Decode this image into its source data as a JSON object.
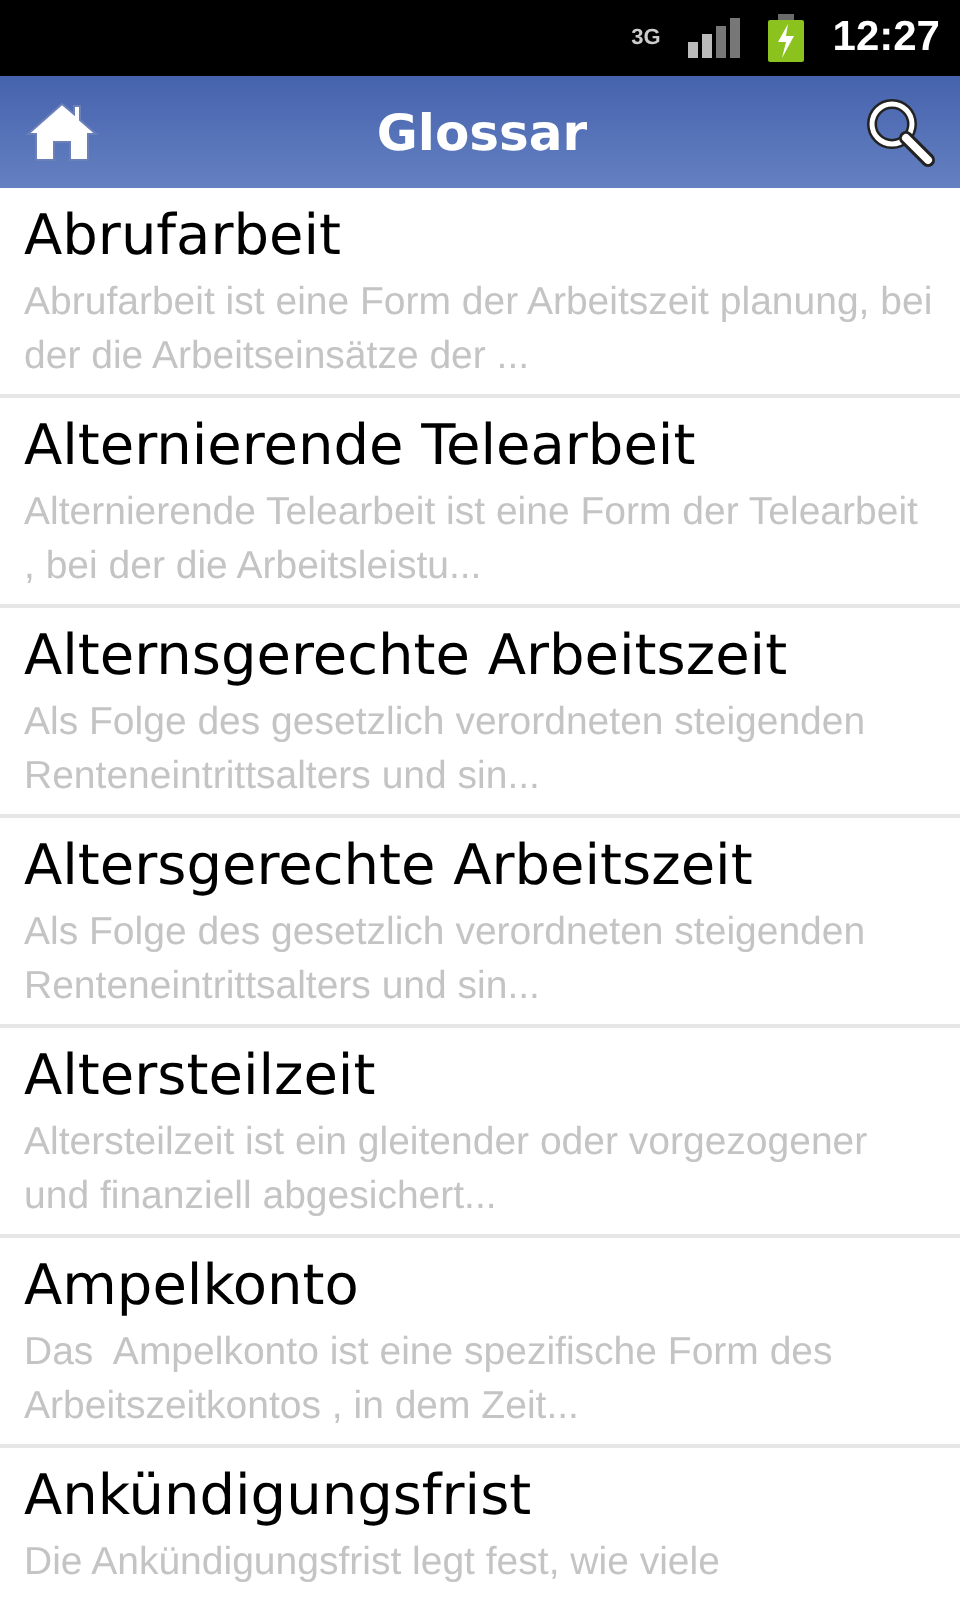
{
  "status_bar": {
    "network": "3G",
    "time": "12:27"
  },
  "header": {
    "title": "Glossar"
  },
  "entries": [
    {
      "term": "Abrufarbeit",
      "summary": "Abrufarbeit ist eine Form der Arbeitszeit planung, bei der die Arbeitseinsätze der ..."
    },
    {
      "term": "Alternierende Telearbeit",
      "summary": "Alternierende Telearbeit ist eine Form der Telearbeit , bei der die Arbeitsleistu..."
    },
    {
      "term": "Alternsgerechte Arbeitszeit",
      "summary": "Als Folge des gesetzlich verordneten steigenden Renteneintrittsalters und sin..."
    },
    {
      "term": "Altersgerechte Arbeitszeit",
      "summary": "Als Folge des gesetzlich verordneten steigenden Renteneintrittsalters und sin..."
    },
    {
      "term": "Altersteilzeit",
      "summary": "Altersteilzeit ist ein gleitender oder vorgezogener und finanziell abgesichert..."
    },
    {
      "term": "Ampelkonto",
      "summary": "Das  Ampelkonto ist eine spezifische Form des Arbeitszeitkontos , in dem Zeit..."
    },
    {
      "term": "Ankündigungsfrist",
      "summary": "Die Ankündigungsfrist legt fest, wie viele"
    }
  ]
}
